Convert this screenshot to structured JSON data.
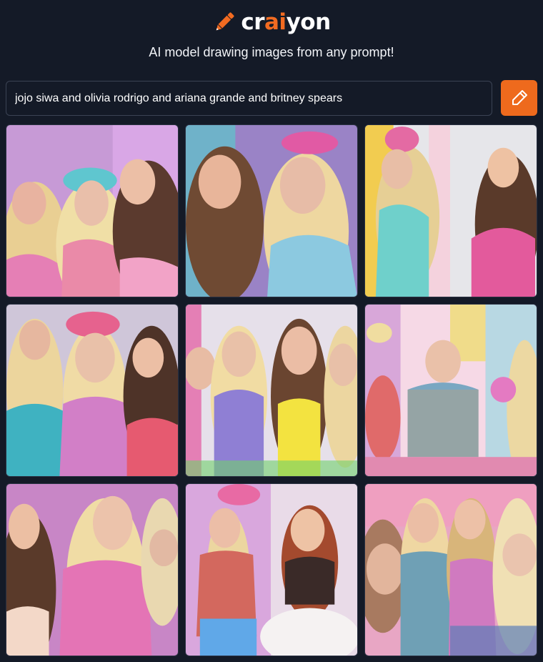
{
  "app": {
    "logo_pre": "cr",
    "logo_accent": "ai",
    "logo_post": "yon",
    "logo_icon": "pencil-icon",
    "tagline": "AI model drawing images from any prompt!",
    "accent_color": "#f26b21",
    "background_color": "#141a27"
  },
  "prompt": {
    "value": "jojo siwa and olivia rodrigo and ariana grande and britney spears"
  },
  "draw_button": {
    "icon": "pencil-icon"
  },
  "results": {
    "images": [
      {
        "scene": "three-people-selfie"
      },
      {
        "scene": "two-people-portrait"
      },
      {
        "scene": "two-people-wide"
      },
      {
        "scene": "three-people-group"
      },
      {
        "scene": "four-people-lineup"
      },
      {
        "scene": "collage-panels"
      },
      {
        "scene": "two-people-close"
      },
      {
        "scene": "two-people-full-body"
      },
      {
        "scene": "four-people-crowd"
      }
    ]
  }
}
